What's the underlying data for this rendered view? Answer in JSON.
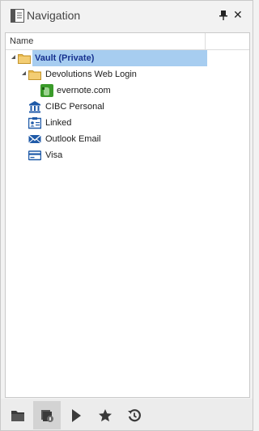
{
  "panel": {
    "title": "Navigation",
    "title_icon": "navigation-panel-icon",
    "pin_icon": "pin-icon",
    "close_glyph": "✕"
  },
  "tree": {
    "column_header": "Name",
    "items": [
      {
        "label": "Vault (Private)",
        "icon": "folder-icon",
        "selected": true,
        "expanded": true
      },
      {
        "label": "Devolutions Web Login",
        "icon": "folder-icon",
        "expanded": true
      },
      {
        "label": "evernote.com",
        "icon": "evernote-icon"
      },
      {
        "label": "CIBC Personal",
        "icon": "bank-icon"
      },
      {
        "label": "Linked",
        "icon": "contact-card-icon"
      },
      {
        "label": "Outlook Email",
        "icon": "email-icon"
      },
      {
        "label": "Visa",
        "icon": "credit-card-icon"
      }
    ]
  },
  "toolbar": {
    "buttons": [
      {
        "name": "folder-view",
        "icon": "folder-icon"
      },
      {
        "name": "entries-view",
        "icon": "entries-icon",
        "active": true
      },
      {
        "name": "play",
        "icon": "play-icon"
      },
      {
        "name": "favorites",
        "icon": "star-icon"
      },
      {
        "name": "recent",
        "icon": "history-icon"
      }
    ]
  },
  "colors": {
    "selection": "#a7cdf0",
    "vault_text": "#16318f",
    "folder": "#e9b94c",
    "icon_blue": "#1f5aa8",
    "evernote_green": "#3a9b2a"
  }
}
